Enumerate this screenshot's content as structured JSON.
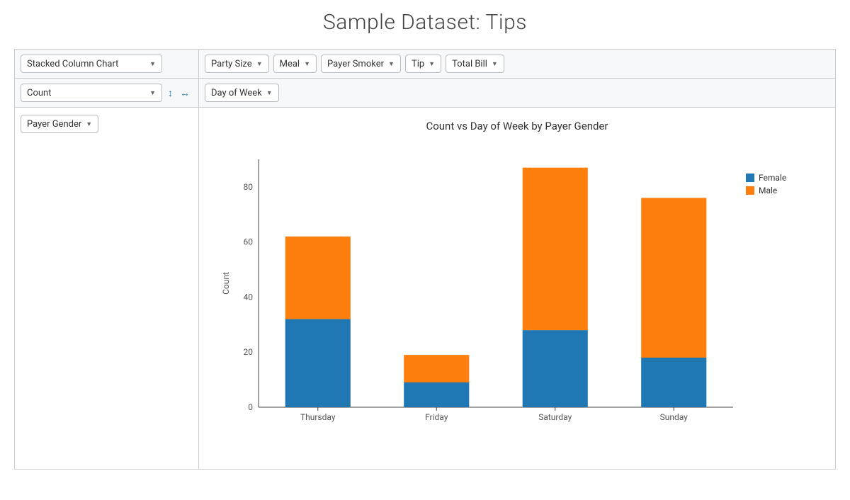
{
  "title": "Sample Dataset: Tips",
  "controls": {
    "chart_type": "Stacked Column Chart",
    "aggregator": "Count",
    "column_field": "Day of Week",
    "row_field": "Payer Gender",
    "unused_fields": [
      "Party Size",
      "Meal",
      "Payer Smoker",
      "Tip",
      "Total Bill"
    ]
  },
  "chart_data": {
    "type": "bar",
    "stacked": true,
    "title": "Count vs Day of Week by Payer Gender",
    "xlabel": "",
    "ylabel": "Count",
    "categories": [
      "Thursday",
      "Friday",
      "Saturday",
      "Sunday"
    ],
    "series": [
      {
        "name": "Female",
        "color": "#1f77b4",
        "values": [
          32,
          9,
          28,
          18
        ]
      },
      {
        "name": "Male",
        "color": "#ff7f0e",
        "values": [
          30,
          10,
          59,
          58
        ]
      }
    ],
    "ylim": [
      0,
      90
    ],
    "yticks": [
      0,
      20,
      40,
      60,
      80
    ]
  }
}
